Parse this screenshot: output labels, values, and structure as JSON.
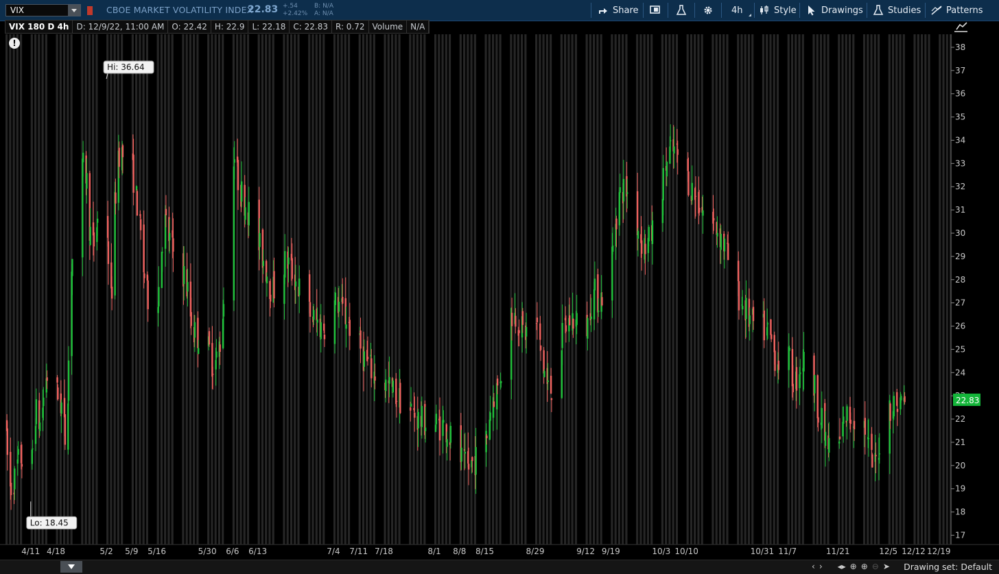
{
  "header": {
    "symbol": "VIX",
    "full_name": "CBOE MARKET VOLATILITY INDEX",
    "last": "22.83",
    "change": "+.54",
    "change_pct": "+2.42%",
    "bid": "B: N/A",
    "ask": "A: N/A",
    "share_label": "Share",
    "aggregation_label": "4h",
    "style_label": "Style",
    "drawings_label": "Drawings",
    "studies_label": "Studies",
    "patterns_label": "Patterns"
  },
  "info": {
    "title": "VIX 180 D 4h",
    "date": "D: 12/9/22, 11:00 AM",
    "open": "O: 22.42",
    "high": "H: 22.9",
    "low": "L: 22.18",
    "close": "C: 22.83",
    "range": "R: 0.72",
    "volume_label": "Volume",
    "volume_value": "N/A"
  },
  "footer": {
    "drawing_set": "Drawing set: Default"
  },
  "colors": {
    "up": "#1fc23a",
    "down": "#f0625f",
    "last_badge": "#14b53a",
    "background": "#000000",
    "stripe": "#262626"
  },
  "chart_data": {
    "type": "candlestick",
    "title": "VIX 180 D 4h",
    "ylim": [
      16.6,
      38.5
    ],
    "y_ticks": [
      17,
      18,
      19,
      20,
      21,
      22,
      23,
      24,
      25,
      26,
      27,
      28,
      29,
      30,
      31,
      32,
      33,
      34,
      35,
      36,
      37,
      38
    ],
    "x_range": [
      "2022-04-04",
      "2022-12-22"
    ],
    "x_ticks": [
      "4/11",
      "4/18",
      "5/2",
      "5/9",
      "5/16",
      "5/30",
      "6/6",
      "6/13",
      "7/4",
      "7/11",
      "7/18",
      "8/1",
      "8/8",
      "8/15",
      "8/29",
      "9/12",
      "9/19",
      "10/3",
      "10/10",
      "10/31",
      "11/7",
      "11/21",
      "12/5",
      "12/12",
      "12/19"
    ],
    "tick_dates": [
      "2022-04-11",
      "2022-04-18",
      "2022-05-02",
      "2022-05-09",
      "2022-05-16",
      "2022-05-30",
      "2022-06-06",
      "2022-06-13",
      "2022-07-04",
      "2022-07-11",
      "2022-07-18",
      "2022-08-01",
      "2022-08-08",
      "2022-08-15",
      "2022-08-29",
      "2022-09-12",
      "2022-09-19",
      "2022-10-03",
      "2022-10-10",
      "2022-10-31",
      "2022-11-07",
      "2022-11-21",
      "2022-12-05",
      "2022-12-12",
      "2022-12-19"
    ],
    "approx_path": [
      [
        "2022-04-04",
        22.2
      ],
      [
        "2022-04-05",
        18.9
      ],
      [
        "2022-04-07",
        19.6
      ],
      [
        "2022-04-08",
        20.6
      ],
      [
        "2022-04-11",
        18.6
      ],
      [
        "2022-04-12",
        22.5
      ],
      [
        "2022-04-14",
        21.6
      ],
      [
        "2022-04-15",
        24.0
      ],
      [
        "2022-04-18",
        23.2
      ],
      [
        "2022-04-20",
        22.4
      ],
      [
        "2022-04-21",
        20.2
      ],
      [
        "2022-04-22",
        28.2
      ],
      [
        "2022-04-26",
        33.4
      ],
      [
        "2022-04-28",
        29.0
      ],
      [
        "2022-05-02",
        33.0
      ],
      [
        "2022-05-03",
        25.5
      ],
      [
        "2022-05-05",
        33.6
      ],
      [
        "2022-05-09",
        33.0
      ],
      [
        "2022-05-11",
        30.8
      ],
      [
        "2022-05-13",
        27.4
      ],
      [
        "2022-05-16",
        26.6
      ],
      [
        "2022-05-18",
        30.7
      ],
      [
        "2022-05-20",
        29.4
      ],
      [
        "2022-05-24",
        28.1
      ],
      [
        "2022-05-26",
        25.8
      ],
      [
        "2022-05-30",
        25.2
      ],
      [
        "2022-06-01",
        24.2
      ],
      [
        "2022-06-03",
        25.6
      ],
      [
        "2022-06-06",
        33.8
      ],
      [
        "2022-06-08",
        31.9
      ],
      [
        "2022-06-10",
        31.2
      ],
      [
        "2022-06-13",
        29.6
      ],
      [
        "2022-06-15",
        28.7
      ],
      [
        "2022-06-17",
        27.4
      ],
      [
        "2022-06-21",
        28.9
      ],
      [
        "2022-06-24",
        27.8
      ],
      [
        "2022-06-28",
        26.4
      ],
      [
        "2022-07-01",
        25.9
      ],
      [
        "2022-07-05",
        27.1
      ],
      [
        "2022-07-08",
        26.2
      ],
      [
        "2022-07-11",
        25.2
      ],
      [
        "2022-07-13",
        24.5
      ],
      [
        "2022-07-15",
        24.0
      ],
      [
        "2022-07-18",
        23.6
      ],
      [
        "2022-07-21",
        23.1
      ],
      [
        "2022-07-26",
        22.3
      ],
      [
        "2022-07-28",
        21.9
      ],
      [
        "2022-08-01",
        21.8
      ],
      [
        "2022-08-04",
        21.7
      ],
      [
        "2022-08-08",
        20.4
      ],
      [
        "2022-08-10",
        19.8
      ],
      [
        "2022-08-12",
        20.2
      ],
      [
        "2022-08-15",
        20.7
      ],
      [
        "2022-08-17",
        22.9
      ],
      [
        "2022-08-19",
        23.5
      ],
      [
        "2022-08-22",
        26.6
      ],
      [
        "2022-08-24",
        26.4
      ],
      [
        "2022-08-26",
        25.6
      ],
      [
        "2022-08-29",
        26.5
      ],
      [
        "2022-08-31",
        24.4
      ],
      [
        "2022-09-02",
        23.0
      ],
      [
        "2022-09-06",
        25.8
      ],
      [
        "2022-09-08",
        26.4
      ],
      [
        "2022-09-12",
        25.6
      ],
      [
        "2022-09-14",
        27.5
      ],
      [
        "2022-09-16",
        27.1
      ],
      [
        "2022-09-19",
        28.5
      ],
      [
        "2022-09-21",
        31.5
      ],
      [
        "2022-09-23",
        32.0
      ],
      [
        "2022-09-26",
        30.6
      ],
      [
        "2022-09-28",
        29.4
      ],
      [
        "2022-09-30",
        29.7
      ],
      [
        "2022-10-03",
        31.8
      ],
      [
        "2022-10-05",
        33.4
      ],
      [
        "2022-10-07",
        33.5
      ],
      [
        "2022-10-10",
        32.5
      ],
      [
        "2022-10-12",
        31.7
      ],
      [
        "2022-10-14",
        31.1
      ],
      [
        "2022-10-17",
        30.4
      ],
      [
        "2022-10-19",
        30.1
      ],
      [
        "2022-10-21",
        29.2
      ],
      [
        "2022-10-24",
        27.5
      ],
      [
        "2022-10-26",
        26.8
      ],
      [
        "2022-10-28",
        26.1
      ],
      [
        "2022-10-31",
        25.9
      ],
      [
        "2022-11-02",
        25.6
      ],
      [
        "2022-11-04",
        24.5
      ],
      [
        "2022-11-07",
        24.8
      ],
      [
        "2022-11-09",
        23.4
      ],
      [
        "2022-11-11",
        24.6
      ],
      [
        "2022-11-14",
        23.7
      ],
      [
        "2022-11-16",
        22.2
      ],
      [
        "2022-11-18",
        20.8
      ],
      [
        "2022-11-21",
        20.6
      ],
      [
        "2022-11-23",
        22.1
      ],
      [
        "2022-11-28",
        22.1
      ],
      [
        "2022-11-30",
        20.4
      ],
      [
        "2022-12-01",
        19.7
      ],
      [
        "2022-12-02",
        20.6
      ],
      [
        "2022-12-05",
        22.6
      ],
      [
        "2022-12-07",
        22.6
      ],
      [
        "2022-12-09",
        22.83
      ]
    ],
    "annotations": [
      {
        "label": "Hi: 36.64",
        "date": "2022-05-02",
        "value": 36.64
      },
      {
        "label": "Lo: 18.45",
        "date": "2022-04-11",
        "value": 18.45
      }
    ],
    "last_price": 22.83
  }
}
